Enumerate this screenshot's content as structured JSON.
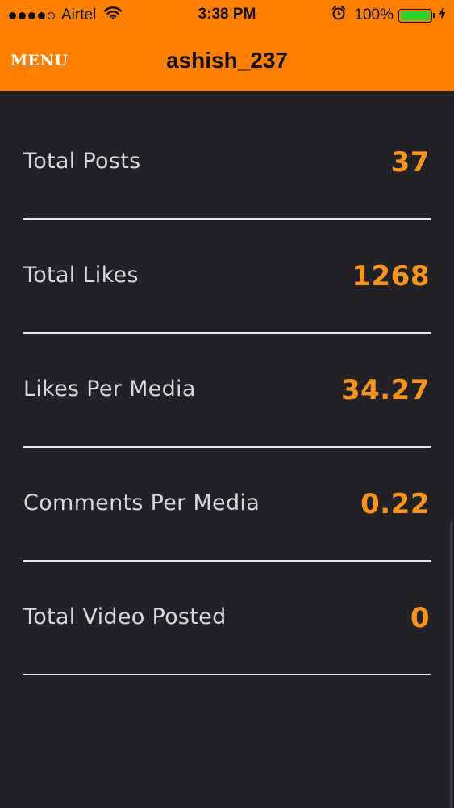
{
  "status_bar": {
    "carrier": "Airtel",
    "time": "3:38 PM",
    "battery_percent": "100%",
    "signal_bars_filled": 4,
    "signal_bars_total": 5,
    "battery_level": 1.0,
    "icons": [
      "wifi-icon",
      "alarm-icon",
      "battery-icon",
      "charge-icon"
    ]
  },
  "nav": {
    "menu_label": "MENU",
    "title": "ashish_237"
  },
  "colors": {
    "header": "#ff7f00",
    "background": "#222226",
    "value": "#f7941d",
    "label": "#d8d8d8",
    "divider": "#e8e8e8"
  },
  "stats": [
    {
      "label": "Total Posts",
      "value": "37"
    },
    {
      "label": "Total Likes",
      "value": "1268"
    },
    {
      "label": "Likes Per Media",
      "value": "34.27"
    },
    {
      "label": "Comments Per Media",
      "value": "0.22"
    },
    {
      "label": "Total Video Posted",
      "value": "0"
    }
  ]
}
